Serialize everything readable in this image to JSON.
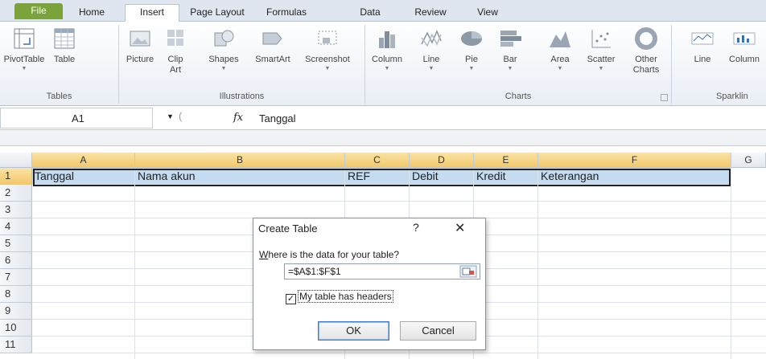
{
  "tabs": [
    {
      "label": "File"
    },
    {
      "label": "Home"
    },
    {
      "label": "Insert"
    },
    {
      "label": "Page Layout"
    },
    {
      "label": "Formulas"
    },
    {
      "label": "Data"
    },
    {
      "label": "Review"
    },
    {
      "label": "View"
    }
  ],
  "ribbon": {
    "buttons": {
      "pivottable": "PivotTable",
      "table": "Table",
      "picture": "Picture",
      "clipart1": "Clip",
      "clipart2": "Art",
      "shapes": "Shapes",
      "smartart": "SmartArt",
      "screenshot": "Screenshot",
      "column": "Column",
      "line": "Line",
      "pie": "Pie",
      "bar": "Bar",
      "area": "Area",
      "scatter": "Scatter",
      "other1": "Other",
      "other2": "Charts",
      "spark_line": "Line",
      "spark_column": "Column"
    },
    "groups": {
      "tables": "Tables",
      "illustrations": "Illustrations",
      "charts": "Charts",
      "sparklines": "Sparklin"
    }
  },
  "formula_bar": {
    "name_box": "A1",
    "fx": "fx",
    "formula": "Tanggal"
  },
  "grid": {
    "columns": [
      "A",
      "B",
      "C",
      "D",
      "E",
      "F",
      "G"
    ],
    "rows": [
      "1",
      "2",
      "3",
      "4",
      "5",
      "6",
      "7",
      "8",
      "9",
      "10",
      "11"
    ],
    "row1": [
      "Tanggal",
      "Nama akun",
      "REF",
      "Debit",
      "Kredit",
      "Keterangan"
    ]
  },
  "dialog": {
    "title": "Create Table",
    "help": "?",
    "close": "✕",
    "question": "Where is the data for your table?",
    "range": "=$A$1:$F$1",
    "checkbox_label": "My table has headers",
    "checked": true,
    "ok": "OK",
    "cancel": "Cancel"
  },
  "colors": {
    "file_tab": "#7aa33c",
    "header_row": "#c5dcf0",
    "selected_header": "#f2c96b"
  }
}
